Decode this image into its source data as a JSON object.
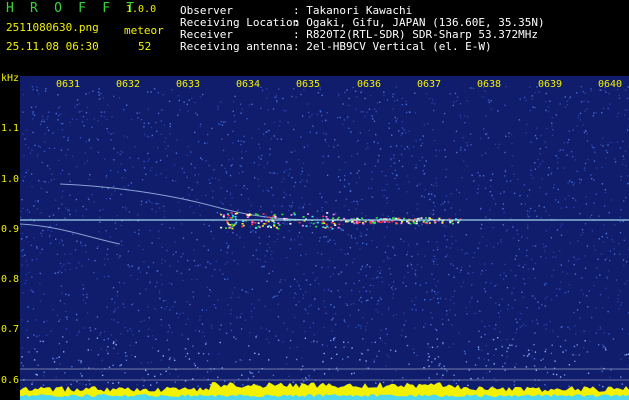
{
  "header": {
    "app_name": "H R O F F T",
    "version": "1.0.0",
    "file_name": "2511080630.png",
    "datetime": "25.11.08 06:30",
    "meteor_label": "meteor",
    "meteor_count": "52",
    "info_labels": [
      "Observer",
      "Receiving Location",
      "Receiver",
      "Receiving antenna"
    ],
    "info_values": [
      ": Takanori Kawachi",
      ": Ogaki, Gifu, JAPAN (136.60E, 35.35N)",
      ": R820T2(RTL-SDR) SDR-Sharp 53.372MHz",
      ": 2el-HB9CV Vertical (el. E-W)"
    ]
  },
  "spectrogram": {
    "y_unit": "kHz",
    "y_ticks": [
      "1.1",
      "1.0",
      "0.9",
      "0.8",
      "0.7",
      "0.6"
    ],
    "x_ticks": [
      "0631",
      "0632",
      "0633",
      "0634",
      "0635",
      "0636",
      "0637",
      "0638",
      "0639",
      "0640"
    ],
    "colors": {
      "background": "#101c6c",
      "label": "#f2f200",
      "carrier": "#9cd6e8",
      "noise_floor": "#f2f200"
    }
  }
}
